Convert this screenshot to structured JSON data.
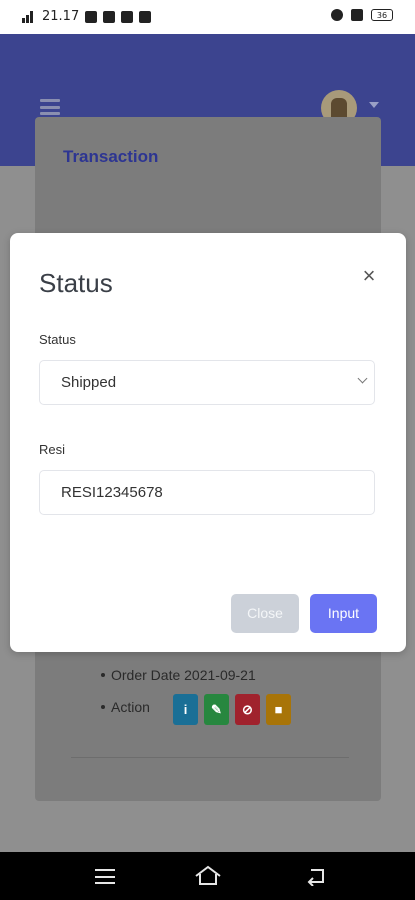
{
  "status_bar": {
    "time": "21.17",
    "battery": "36"
  },
  "header": {
    "menu_icon": "hamburger-icon",
    "avatar_icon": "user-avatar"
  },
  "card": {
    "title": "Transaction",
    "order_date_label": "Order Date 2021-09-21",
    "action_label": "Action",
    "action_buttons": [
      {
        "icon": "info-icon",
        "color": "#1a6f96"
      },
      {
        "icon": "edit-icon",
        "color": "#27873f"
      },
      {
        "icon": "block-icon",
        "color": "#a0222d"
      },
      {
        "icon": "trash-icon",
        "color": "#a87408"
      }
    ]
  },
  "modal": {
    "title": "Status",
    "status_label": "Status",
    "status_value": "Shipped",
    "resi_label": "Resi",
    "resi_value": "RESI12345678",
    "close_button": "Close",
    "input_button": "Input",
    "accent_color": "#6a74f3"
  }
}
